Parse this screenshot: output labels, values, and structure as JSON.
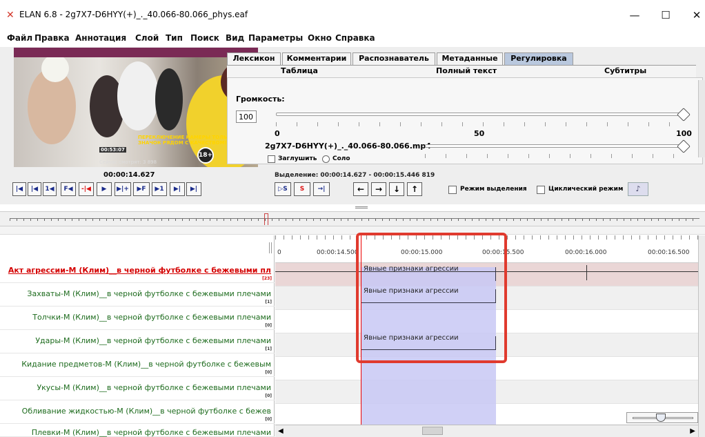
{
  "window": {
    "title": "ELAN 6.8 - 2g7X7-D6HYY(+)_._40.066-80.066_phys.eaf",
    "min": "—",
    "max": "☐",
    "close": "✕"
  },
  "menu": [
    "Файл",
    "Правка",
    "Аннотация",
    "Слой",
    "Тип",
    "Поиск",
    "Вид",
    "Параметры",
    "Окно",
    "Справка"
  ],
  "tabs": [
    "Лексикон",
    "Комментарии",
    "Распознаватель",
    "Метаданные",
    "Регулировка"
  ],
  "subtabs": [
    "Таблица",
    "Полный текст",
    "Субтитры"
  ],
  "volume": {
    "label": "Громкость:",
    "value": "100",
    "scale_min": "0",
    "scale_mid": "50",
    "scale_max": "100",
    "level": 1.0
  },
  "media": {
    "file": "2g7X7-D6HYY(+)_._40.066-80.066.mp4",
    "mute": "Заглушить",
    "solo": "Соло",
    "partial_scale": [
      "0",
      "25",
      "50",
      "75",
      "100"
    ]
  },
  "video_overlay": {
    "line1": "ПЕРЕКЛЮЧЕНИЕ КАМЕРЫ ТОЛЬКО С ПК",
    "line2": "ЗНАЧОК РЯДОМ С КАЧЕСТВОМ!",
    "clock": "00:53:07",
    "viewers": "Сейчас смотрят: 3 898",
    "age": "18+"
  },
  "current_time": "00:00:14.627",
  "selection": "Выделение: 00:00:14.627 - 00:00:15.446  819",
  "player_buttons": [
    "|◀",
    "|◀",
    "1◀",
    "F◀",
    "-|◀",
    "▶",
    "▶|+",
    "▶F",
    "▶1",
    "▶|",
    "▶|"
  ],
  "selection_buttons": [
    "▷S",
    "S",
    "→|"
  ],
  "nav_buttons": [
    "←",
    "→",
    "↓",
    "↑"
  ],
  "checkboxes": {
    "selection_mode": "Режим выделения",
    "loop_mode": "Циклический режим"
  },
  "ruler": [
    "0",
    "00:00:14.500",
    "00:00:15.000",
    "00:00:15.500",
    "00:00:16.000",
    "00:00:16.500"
  ],
  "tiers": [
    {
      "name": "Акт агрессии-М (Клим)__в черной футболке с бежевыми пл",
      "count": "[23]",
      "active": true
    },
    {
      "name": "Захваты-М (Клим)__в черной футболке с бежевыми плечами",
      "count": "[1]"
    },
    {
      "name": "Толчки-М (Клим)__в черной футболке с бежевыми плечами",
      "count": "[0]"
    },
    {
      "name": "Удары-М (Клим)__в черной футболке с бежевыми плечами",
      "count": "[1]"
    },
    {
      "name": "Кидание предметов-М (Клим)__в черной футболке с бежевым",
      "count": "[0]"
    },
    {
      "name": "Укусы-М (Клим)__в черной футболке с бежевыми плечами",
      "count": "[0]"
    },
    {
      "name": "Обливание жидкостью-М (Клим)__в черной футболке с бежев",
      "count": "[0]"
    },
    {
      "name": "Плевки-М (Клим)__в черной футболке с бежевыми плечами",
      "count": ""
    }
  ],
  "annotations": [
    {
      "tier": 0,
      "text": "Явные признаки агрессии"
    },
    {
      "tier": 1,
      "text": "Явные признаки агрессии"
    },
    {
      "tier": 3,
      "text": "Явные признаки агрессии"
    }
  ]
}
